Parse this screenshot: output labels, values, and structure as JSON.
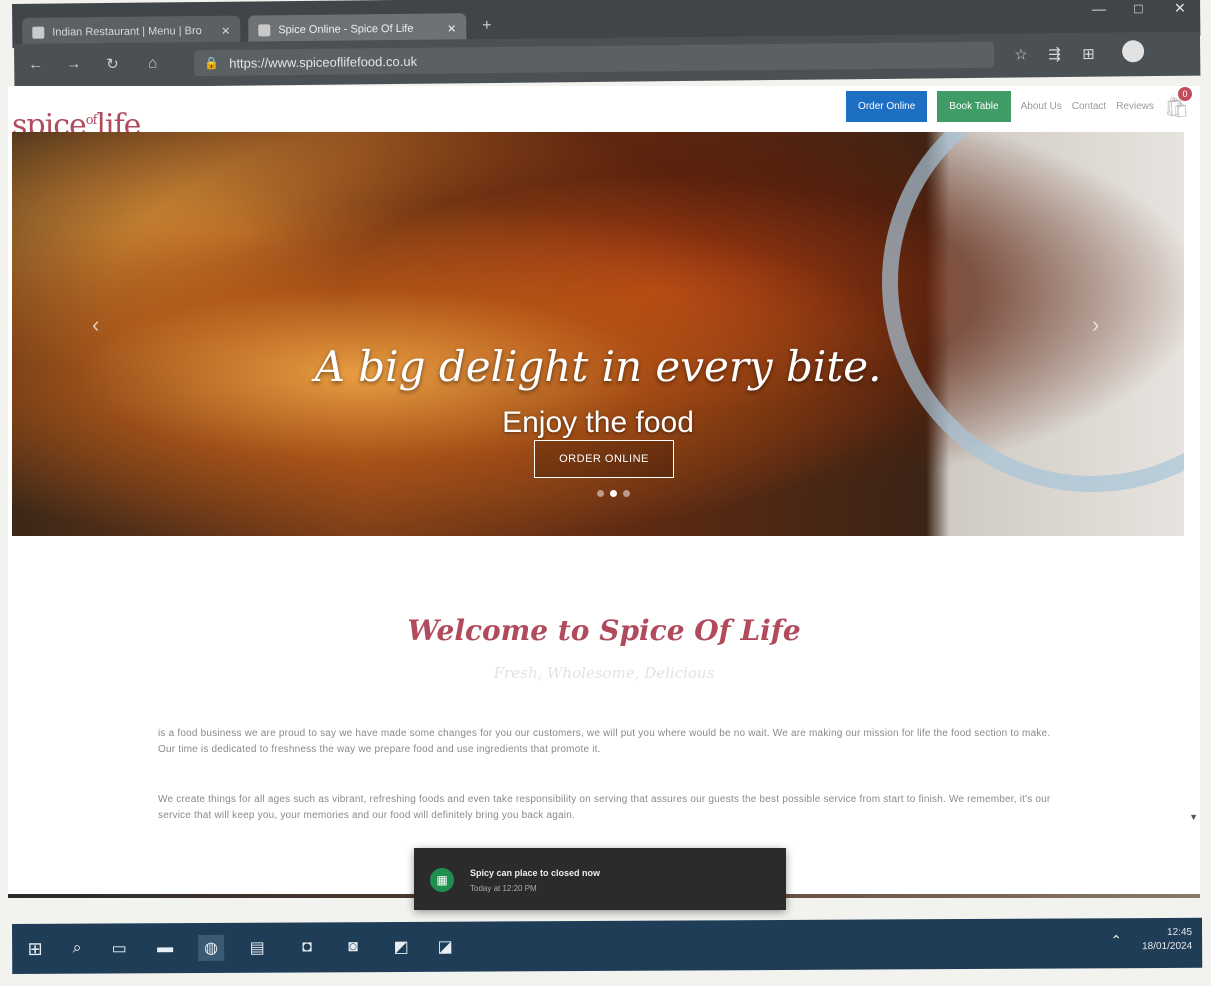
{
  "browser": {
    "tabs": [
      {
        "label": "Indian Restaurant | Menu | Bro",
        "active": false
      },
      {
        "label": "Spice Online - Spice Of Life",
        "active": true
      }
    ],
    "new_tab_icon": "plus-icon",
    "window_controls": {
      "minimize": "—",
      "maximize": "□",
      "close": "✕"
    },
    "url": "https://www.spiceoflifefood.co.uk",
    "nav_icons": {
      "back": "←",
      "forward": "→",
      "refresh": "↻",
      "home": "⌂",
      "lock": "🔒"
    },
    "toolbar_icons": [
      "☆",
      "⇶",
      "⊞"
    ]
  },
  "site": {
    "logo_main": "spice",
    "logo_of": "of",
    "logo_end": "life",
    "nav": {
      "order_online": "Order Online",
      "book_table": "Book Table",
      "about": "About Us",
      "contact": "Contact",
      "reviews": "Reviews",
      "cart_count": "0"
    },
    "hero": {
      "headline": "A big delight in every bite.",
      "subheadline": "Enjoy the food",
      "cta": "ORDER ONLINE",
      "slide_count": 3,
      "active_slide": 1
    },
    "welcome": {
      "title": "Welcome to Spice Of Life",
      "subtitle": "Fresh, Wholesome, Delicious"
    },
    "paragraphs": [
      "is a food business we are proud to say we have made some changes for you our customers, we will put you where would be no wait. We are making our mission for life the food section to make. Our time is dedicated to freshness the way we prepare food and use ingredients that promote it.",
      "We create things for all ages such as vibrant, refreshing foods and even take responsibility on serving that assures our guests the best possible service from start to finish. We remember, it's our service that will keep you, your memories and our food will definitely bring you back again."
    ]
  },
  "notification": {
    "title": "Spicy can place to closed now",
    "time": "Today at 12:20 PM",
    "icon": "store-icon"
  },
  "taskbar": {
    "icons": [
      "windows-start-icon",
      "search-icon",
      "task-view-icon",
      "app-icon",
      "edge-icon",
      "file-explorer-icon",
      "outlook-icon",
      "teams-icon",
      "onenote-icon",
      "app-icon-2"
    ],
    "clock_time": "12:45",
    "clock_date": "18/01/2024"
  }
}
